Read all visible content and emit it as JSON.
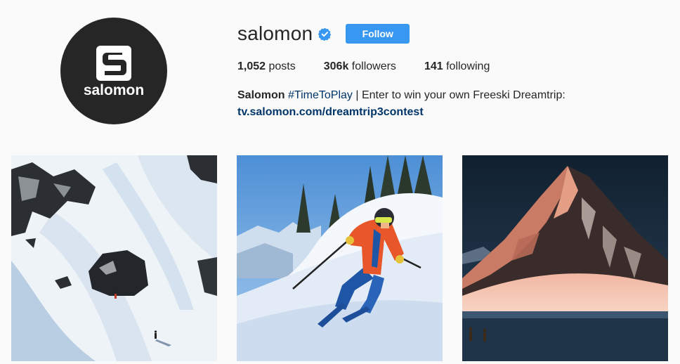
{
  "profile": {
    "username": "salomon",
    "verified_icon": "verified-badge-icon",
    "follow_label": "Follow",
    "avatar_logo_text": "salomon"
  },
  "stats": {
    "posts_count": "1,052",
    "posts_label": "posts",
    "followers_count": "306k",
    "followers_label": "followers",
    "following_count": "141",
    "following_label": "following"
  },
  "bio": {
    "name": "Salomon",
    "hashtag": "#TimeToPlay",
    "text": " | Enter to win your own Freeski Dreamtrip:",
    "link": "tv.salomon.com/dreamtrip3contest"
  },
  "colors": {
    "accent": "#3897f0",
    "link": "#003569",
    "background": "#fafafa"
  },
  "posts": [
    {
      "subject": "skier on snowy slope with rocks"
    },
    {
      "subject": "skier in orange jacket in powder"
    },
    {
      "subject": "pink-lit mountain peak with hikers"
    }
  ]
}
